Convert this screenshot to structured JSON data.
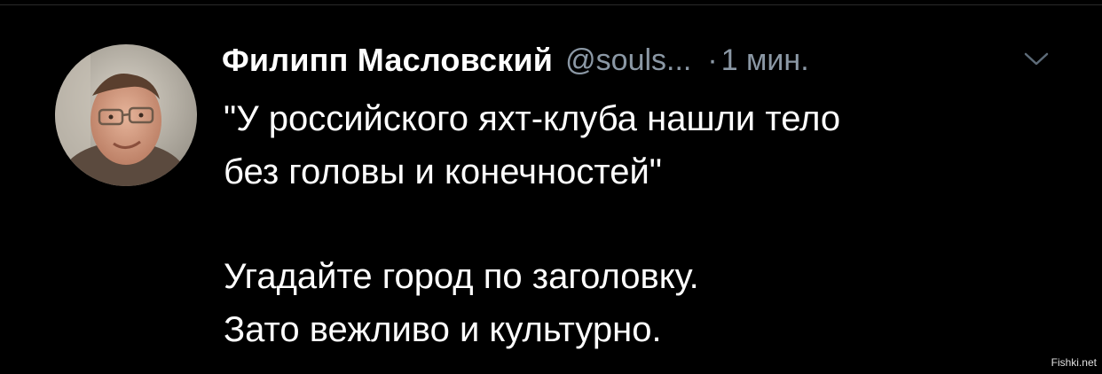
{
  "tweet": {
    "author_name": "Филипп Масловский",
    "author_handle": "@souls...",
    "separator": "·",
    "time": "1 мин.",
    "caret_icon": "chevron-down-icon",
    "lines": [
      "\"У российского яхт-клуба нашли тело",
      "без головы и конечностей\"",
      "Угадайте город по заголовку.",
      "Зато вежливо и культурно."
    ]
  },
  "watermark": "Fishki.net",
  "colors": {
    "background": "#000000",
    "text": "#ffffff",
    "secondary_text": "#8b98a5"
  }
}
